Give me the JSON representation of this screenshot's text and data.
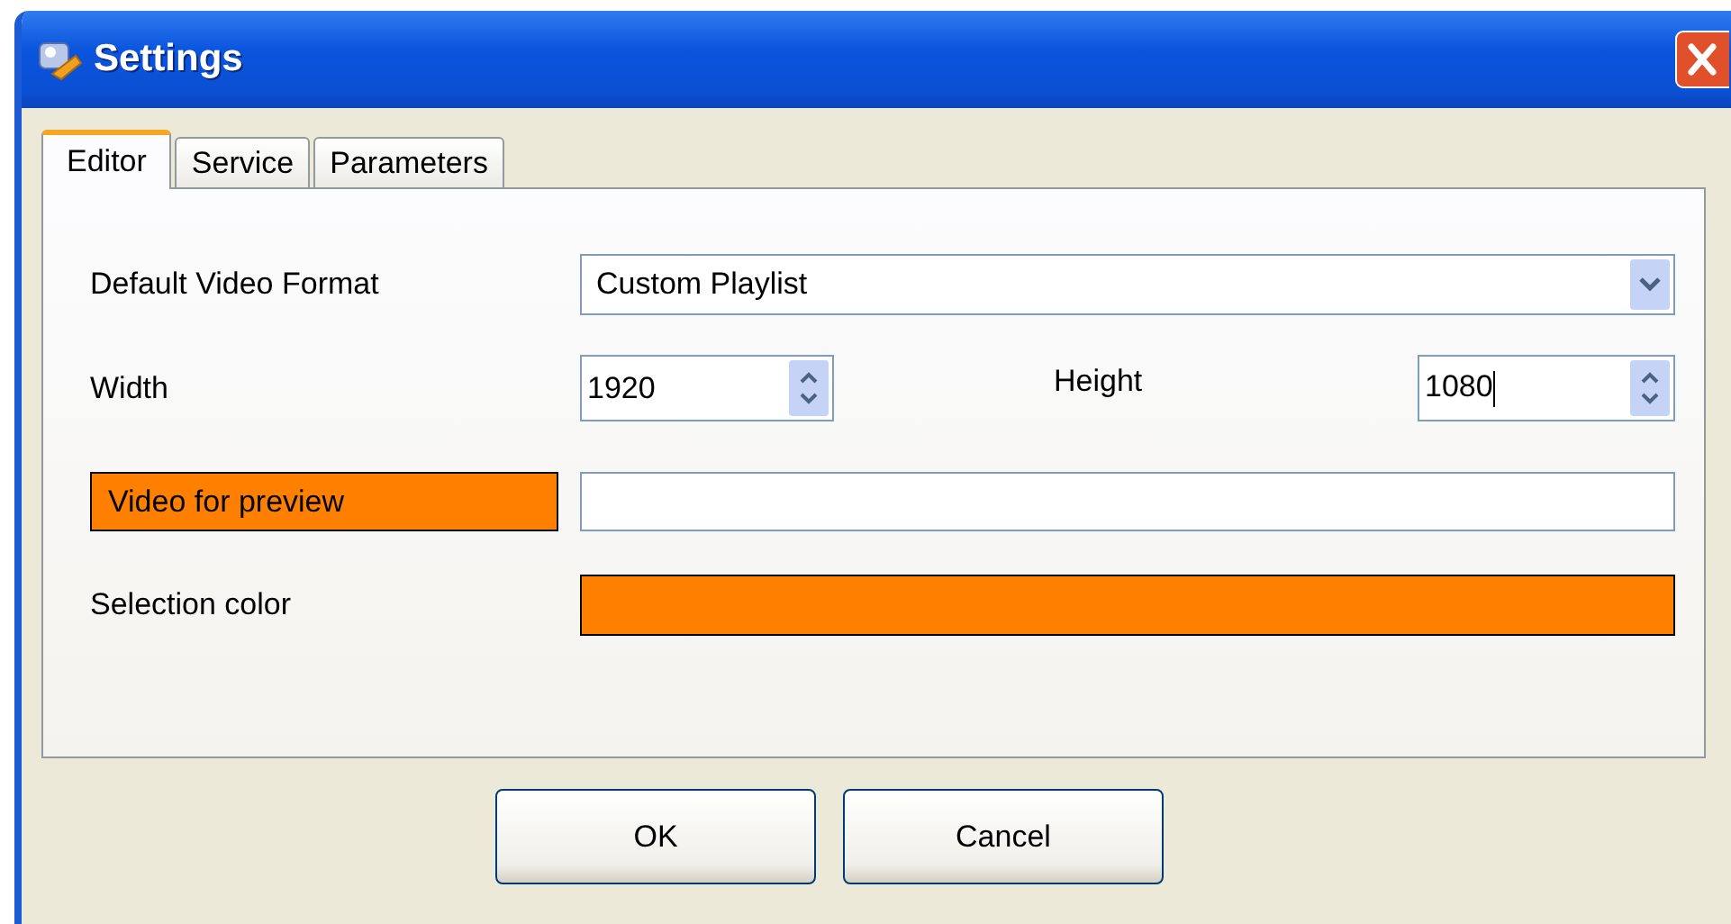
{
  "window": {
    "title": "Settings"
  },
  "tabs": [
    {
      "label": "Editor",
      "selected": true
    },
    {
      "label": "Service",
      "selected": false
    },
    {
      "label": "Parameters",
      "selected": false
    }
  ],
  "editor": {
    "video_format": {
      "label": "Default Video Format",
      "value": "Custom Playlist"
    },
    "width": {
      "label": "Width",
      "value": "1920"
    },
    "height": {
      "label": "Height",
      "value": "1080",
      "focused": true
    },
    "preview": {
      "label": "Video for preview",
      "highlighted": true
    },
    "selection_color": {
      "label": "Selection color",
      "color": "#ff8000"
    }
  },
  "buttons": [
    "OK",
    "Cancel"
  ]
}
